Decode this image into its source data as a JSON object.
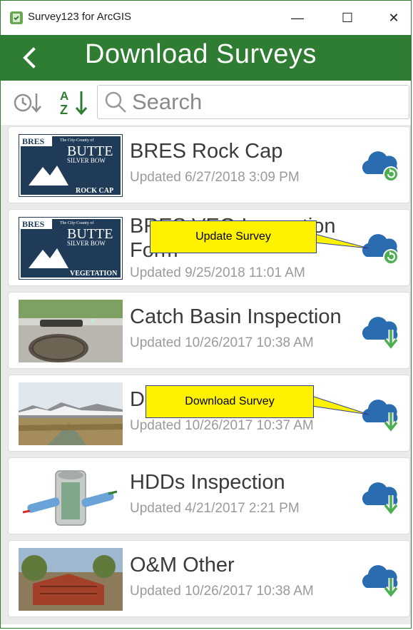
{
  "window": {
    "app_title": "Survey123 for ArcGIS",
    "minimize_glyph": "—",
    "maximize_glyph": "☐",
    "close_glyph": "✕"
  },
  "header": {
    "title": "Download Surveys",
    "back_icon": "chevron-left-icon"
  },
  "toolbar": {
    "sort_time_icon": "clock-sort-icon",
    "sort_az_icon": "az-sort-icon",
    "search_placeholder": "Search"
  },
  "surveys": [
    {
      "title": "BRES Rock Cap",
      "updated": "Updated 6/27/2018 3:09 PM",
      "action": "update",
      "thumb_lines": [
        "BRES",
        "The City-County of",
        "BUTTE",
        "SILVER BOW",
        "ROCK CAP"
      ]
    },
    {
      "title": "BRES VEG Inspection Form",
      "updated": "Updated 9/25/2018 11:01 AM",
      "action": "update",
      "thumb_lines": [
        "BRES",
        "The City-County of",
        "BUTTE",
        "SILVER BOW",
        "VEGETATION"
      ]
    },
    {
      "title": "Catch Basin Inspection",
      "updated": "Updated 10/26/2017 10:38 AM",
      "action": "download"
    },
    {
      "title": "D",
      "updated": "Updated 10/26/2017 10:37 AM",
      "action": "download"
    },
    {
      "title": "HDDs Inspection",
      "updated": "Updated 4/21/2017 2:21 PM",
      "action": "download"
    },
    {
      "title": "O&M Other",
      "updated": "Updated 10/26/2017 10:38 AM",
      "action": "download"
    }
  ],
  "callouts": {
    "update": "Update Survey",
    "download": "Download Survey"
  },
  "colors": {
    "header_green": "#2e7d32",
    "cloud_blue": "#2b6cb0",
    "badge_green": "#4caf50",
    "callout_yellow": "#fff200"
  }
}
